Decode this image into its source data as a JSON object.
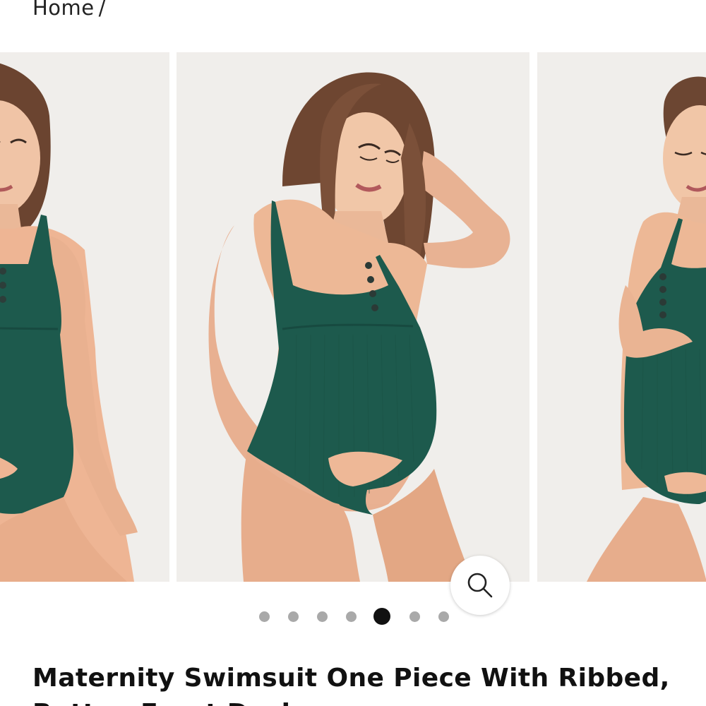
{
  "breadcrumb": {
    "home_label": "Home",
    "separator": "/"
  },
  "gallery": {
    "background_color": "#f0eeeb",
    "swimsuit_color": "#1d5a4d",
    "slides": [
      {
        "position": "previous"
      },
      {
        "position": "current"
      },
      {
        "position": "next"
      }
    ],
    "zoom_icon": "magnifier-icon",
    "pagination": {
      "count": 7,
      "active_index": 4,
      "active_color": "#111111",
      "inactive_color": "#a9a9a9"
    }
  },
  "product": {
    "title": "Maternity Swimsuit One Piece With Ribbed, Button Front Design"
  }
}
